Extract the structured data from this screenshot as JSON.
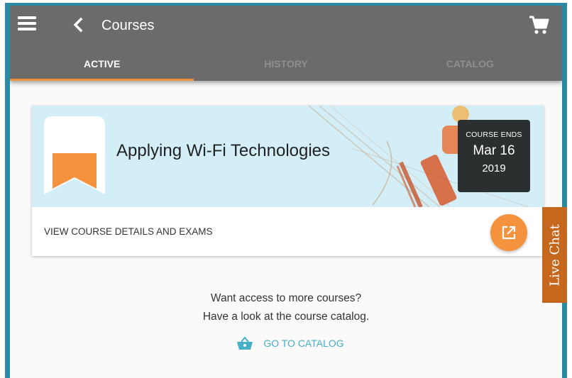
{
  "header": {
    "title": "Courses",
    "tabs": [
      {
        "label": "ACTIVE",
        "active": true
      },
      {
        "label": "HISTORY",
        "active": false
      },
      {
        "label": "CATALOG",
        "active": false
      }
    ]
  },
  "course": {
    "title": "Applying Wi-Fi Technologies",
    "ends_label": "COURSE ENDS",
    "ends_date": "Mar 16",
    "ends_year": "2019",
    "action_label": "VIEW COURSE DETAILS AND EXAMS"
  },
  "promo": {
    "line1": "Want access to more courses?",
    "line2": "Have a look at the course catalog.",
    "link_label": "GO TO CATALOG"
  },
  "live_chat": {
    "label": "Live Chat"
  },
  "colors": {
    "header_bg": "#6b6b6b",
    "accent_orange": "#f5923e",
    "link_teal": "#46aec7",
    "banner_bg": "#d3eef7",
    "live_chat_bg": "#c5671c"
  },
  "icons": [
    "menu-icon",
    "back-arrow-icon",
    "cart-icon",
    "bookmark-icon",
    "open-external-icon",
    "basket-icon"
  ]
}
